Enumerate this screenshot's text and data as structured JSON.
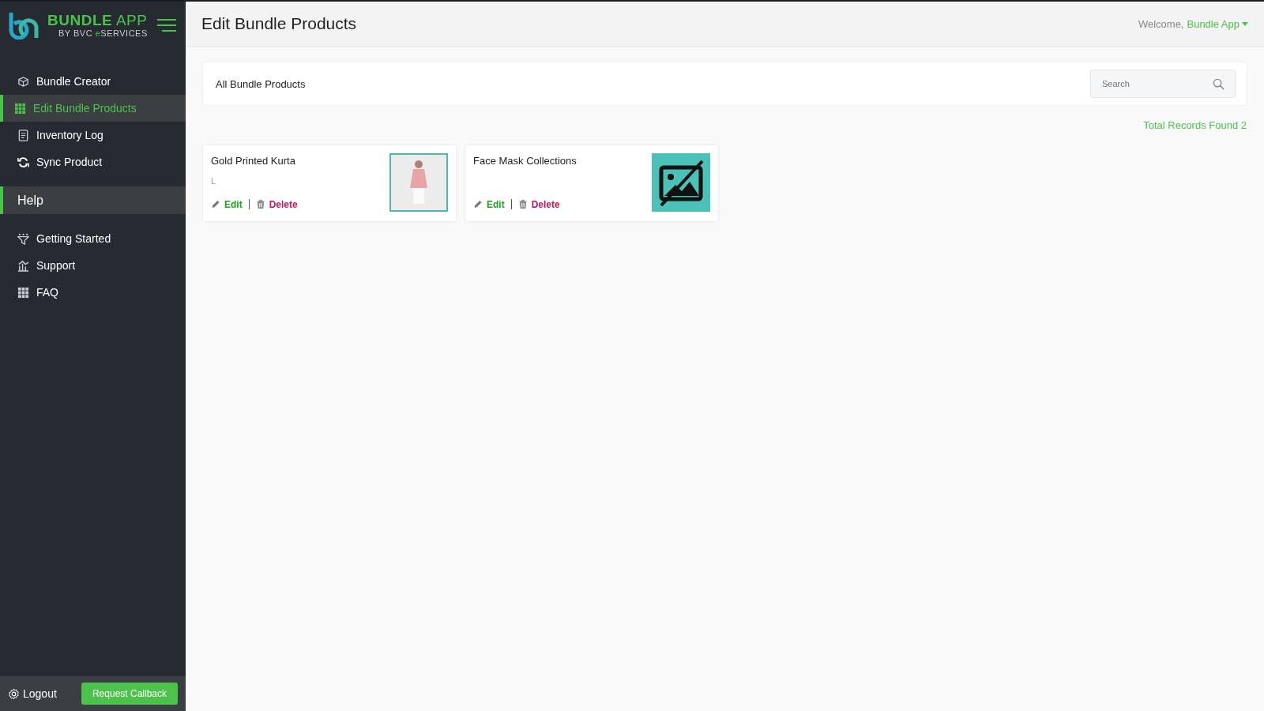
{
  "logo": {
    "title": "**BUNDLE** APP",
    "subtitle": {
      "before": "BY BVC ",
      "accent": "e",
      "after": "SERVICES"
    }
  },
  "nav": [
    {
      "label": "Bundle Creator",
      "selected": false
    },
    {
      "label": "Edit Bundle Products",
      "selected": true
    },
    {
      "label": "Inventory Log",
      "selected": false
    },
    {
      "label": "Sync Product",
      "selected": false
    }
  ],
  "help": {
    "title": "Help",
    "items": [
      {
        "label": "Getting Started"
      },
      {
        "label": "Support"
      },
      {
        "label": "FAQ"
      }
    ]
  },
  "footer": {
    "logout": "Logout",
    "callback": "Request Callback"
  },
  "header": {
    "title": "Edit Bundle Products",
    "welcome": "Welcome,",
    "user": "Bundle App"
  },
  "panel": {
    "title": "All Bundle Products",
    "search": {
      "placeholder": "Search"
    }
  },
  "total": "Total Records Found 2",
  "products": [
    {
      "name": "Gold Printed Kurta",
      "variant": "L",
      "kind": "photo",
      "edit": "Edit",
      "delete": "Delete"
    },
    {
      "name": "Face Mask Collections",
      "kind": "no-image",
      "edit": "Edit",
      "delete": "Delete"
    }
  ]
}
